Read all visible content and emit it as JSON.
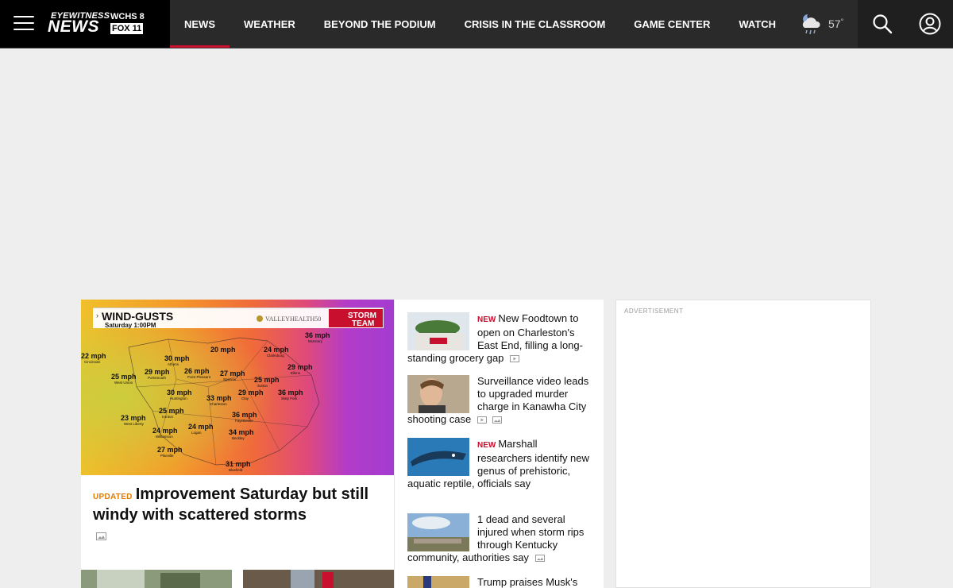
{
  "brand": {
    "line1": "EYEWITNESS",
    "line2": "NEWS",
    "station1": "WCHS 8",
    "station2": "FOX 11"
  },
  "nav": {
    "items": [
      {
        "label": "NEWS",
        "active": true
      },
      {
        "label": "WEATHER"
      },
      {
        "label": "BEYOND THE PODIUM"
      },
      {
        "label": "CRISIS IN THE CLASSROOM"
      },
      {
        "label": "GAME CENTER"
      },
      {
        "label": "WATCH"
      }
    ]
  },
  "weather": {
    "icon": "cloud-rain-night-icon",
    "temp": "57",
    "unit": "°"
  },
  "lead": {
    "map": {
      "title": "WIND-GUSTS",
      "subtitle": "Saturday     1:00PM",
      "sponsor": "VALLEYHEALTH50",
      "team_line1": "STORM",
      "team_line2": "TEAM",
      "readings": [
        {
          "v": "36 mph",
          "c": "McHenry"
        },
        {
          "v": "22 mph",
          "c": "Cincinnati"
        },
        {
          "v": "20 mph",
          "c": ""
        },
        {
          "v": "24 mph",
          "c": "Clarksburg"
        },
        {
          "v": "30 mph",
          "c": "Athens"
        },
        {
          "v": "29 mph",
          "c": "Elkins"
        },
        {
          "v": "25 mph",
          "c": "West Union"
        },
        {
          "v": "29 mph",
          "c": "Portsmouth"
        },
        {
          "v": "26 mph",
          "c": "Point Pleasant"
        },
        {
          "v": "27 mph",
          "c": "Spencer"
        },
        {
          "v": "25 mph",
          "c": "Sutton"
        },
        {
          "v": "30 mph",
          "c": "Huntington"
        },
        {
          "v": "33 mph",
          "c": "Charleston"
        },
        {
          "v": "29 mph",
          "c": "Clay"
        },
        {
          "v": "36 mph",
          "c": "Slaty Fork"
        },
        {
          "v": "25 mph",
          "c": "Ironton"
        },
        {
          "v": "36 mph",
          "c": "Fayetteville"
        },
        {
          "v": "23 mph",
          "c": "West Liberty"
        },
        {
          "v": "24 mph",
          "c": "Logan"
        },
        {
          "v": "24 mph",
          "c": "Williamson"
        },
        {
          "v": "34 mph",
          "c": "Beckley"
        },
        {
          "v": "27 mph",
          "c": "Pikeville"
        },
        {
          "v": "31 mph",
          "c": "Bluefield"
        }
      ]
    },
    "badge": "UPDATED",
    "headline": "Improvement Saturday but still windy with scattered storms"
  },
  "stories": [
    {
      "badge": "NEW",
      "title": "New Foodtown to open on Charleston's East End, filling a long-standing grocery gap"
    },
    {
      "badge": "",
      "title": "Surveillance video leads to upgraded murder charge in Kanawha City shooting case"
    },
    {
      "badge": "NEW",
      "title": "Marshall researchers identify new genus of prehistoric, aquatic reptile, officials say"
    },
    {
      "badge": "",
      "title": "1 dead and several injured when storm rips through Kentucky community, authorities say"
    },
    {
      "badge": "",
      "title": "Trump praises Musk's"
    }
  ],
  "ad": {
    "label": "ADVERTISEMENT"
  }
}
